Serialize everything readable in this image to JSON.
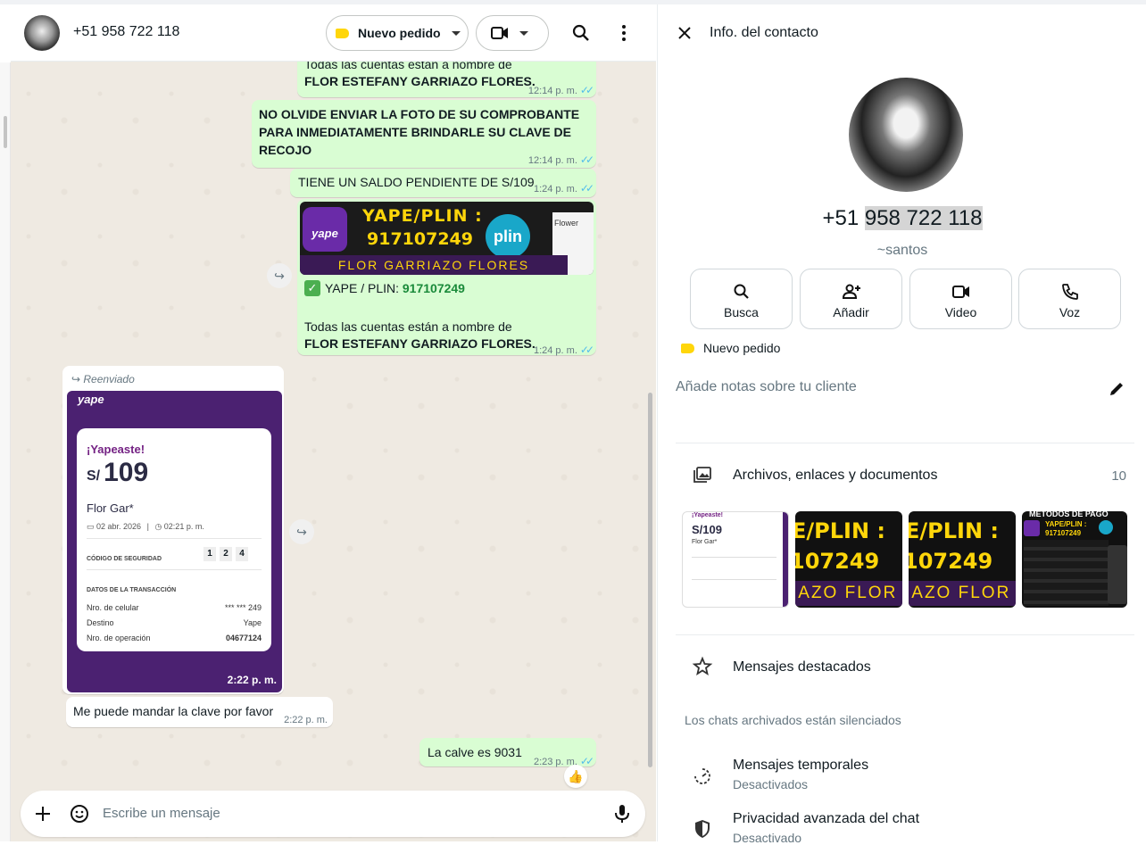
{
  "header": {
    "phone": "+51 958 722 118",
    "label_button": "Nuevo pedido"
  },
  "messages": {
    "m1_line1": "Todas las cuentas están a nombre de",
    "m1_line2": "FLOR ESTEFANY GARRIAZO FLORES.",
    "m1_time": "12:14 p. m.",
    "m2_line1": "NO OLVIDE ENVIAR LA FOTO DE SU COMPROBANTE",
    "m2_line2": "PARA INMEDIATAMENTE BRINDARLE SU CLAVE DE",
    "m2_line3": "RECOJO",
    "m2_time": "12:14 p. m.",
    "m3_text": "TIENE UN SALDO PENDIENTE DE S/109",
    "m3_time": "1:24 p. m.",
    "m4_banner_title": "YAPE/PLIN :",
    "m4_banner_number": "917107249",
    "m4_banner_name": "FLOR GARRIAZO FLORES",
    "m4_banner_yape": "yape",
    "m4_banner_plin": "plin",
    "m4_banner_flower": "Flower",
    "m4_line1_prefix": "YAPE / PLIN: ",
    "m4_line1_number": "917107249",
    "m4_line2": "Todas las cuentas están a nombre de",
    "m4_line3": "FLOR ESTEFANY GARRIAZO FLORES.",
    "m4_time": "1:24 p. m.",
    "m5_forwarded": "Reenviado",
    "m5_time": "2:22 p. m.",
    "m6_text": "Me puede mandar la clave por favor",
    "m6_time": "2:22 p. m.",
    "m7_text": "La calve es 9031",
    "m7_time": "2:23 p. m.",
    "m7_reaction": "👍"
  },
  "receipt": {
    "logo": "yape",
    "headline": "¡Yapeaste!",
    "currency": "S/",
    "amount": "109",
    "name": "Flor Gar*",
    "date": "02 abr. 2026",
    "time": "02:21 p. m.",
    "security_label": "CÓDIGO DE SEGURIDAD",
    "security_digits": [
      "1",
      "2",
      "4"
    ],
    "details_label": "DATOS DE LA TRANSACCIÓN",
    "rows": [
      {
        "k": "Nro. de celular",
        "v": "*** *** 249"
      },
      {
        "k": "Destino",
        "v": "Yape"
      },
      {
        "k": "Nro. de operación",
        "v": "04677124"
      }
    ]
  },
  "composer": {
    "placeholder": "Escribe un mensaje"
  },
  "contact_info": {
    "title": "Info. del contacto",
    "phone_prefix": "+51 ",
    "phone_rest": "958 722 118",
    "alias": "~santos",
    "actions": [
      "Busca",
      "Añadir",
      "Video",
      "Voz"
    ],
    "label": "Nuevo pedido",
    "notes_placeholder": "Añade notas sobre tu cliente",
    "files_label": "Archivos, enlaces y documentos",
    "files_count": "10",
    "starred": "Mensajes destacados",
    "archived_note": "Los chats archivados están silenciados",
    "temp_title": "Mensajes temporales",
    "temp_sub": "Desactivados",
    "privacy_title": "Privacidad avanzada del chat",
    "privacy_sub": "Desactivado"
  },
  "thumbnails": {
    "t1_headline": "¡Yapeaste!",
    "t1_amount": "S/109",
    "t1_name": "Flor Gar*",
    "t2_line1": "E/PLIN :",
    "t2_line2": "107249",
    "t2_line3": "IAZO FLOR",
    "t3_line1": "E/PLIN :",
    "t3_line2": "107249",
    "t3_line3": "IAZO FLOR",
    "t4_line1": "METODOS DE PAGO",
    "t4_line2": "YAPE/PLIN :",
    "t4_line3": "917107249"
  },
  "colors": {
    "outgoing_bubble": "#d9fdd3",
    "chat_bg": "#efeae2",
    "read_ticks": "#53bdeb",
    "label_yellow": "#ffd60a",
    "yape_purple": "#4b2171"
  },
  "icons": [
    "search-icon",
    "menu-icon",
    "video-icon",
    "close-icon",
    "add-user-icon",
    "phone-icon",
    "pencil-icon",
    "gallery-icon",
    "star-icon",
    "timer-icon",
    "shield-icon",
    "plus-icon",
    "sticker-icon",
    "mic-icon",
    "forward-icon",
    "check-icon"
  ]
}
